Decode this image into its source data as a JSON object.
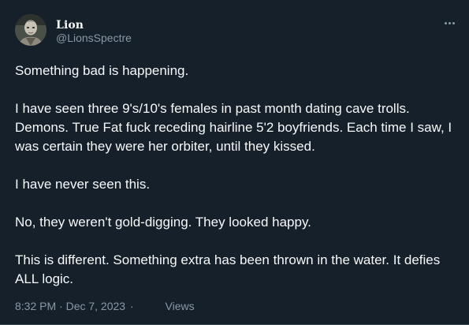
{
  "author": {
    "display_name": "Lion",
    "handle": "@LionsSpectre",
    "avatar_icon": "profile-avatar-icon"
  },
  "more_icon": "ellipsis-icon",
  "tweet": {
    "paragraphs": [
      "Something bad is happening.",
      "I have seen three 9's/10's females in past month dating cave trolls. Demons. True Fat fuck receding hairline 5'2 boyfriends. Each time I saw, I was certain they were her orbiter, until they kissed.",
      "I have never seen this.",
      "No, they weren't gold-digging. They looked happy.",
      "This is different. Something extra has been thrown in the water. It defies ALL logic."
    ],
    "time": "8:32 PM · Dec 7, 2023",
    "separator": "·",
    "views_label": "Views"
  },
  "colors": {
    "background": "#15202b",
    "text_primary": "#f7f9f9",
    "text_secondary": "#8b98a5"
  }
}
